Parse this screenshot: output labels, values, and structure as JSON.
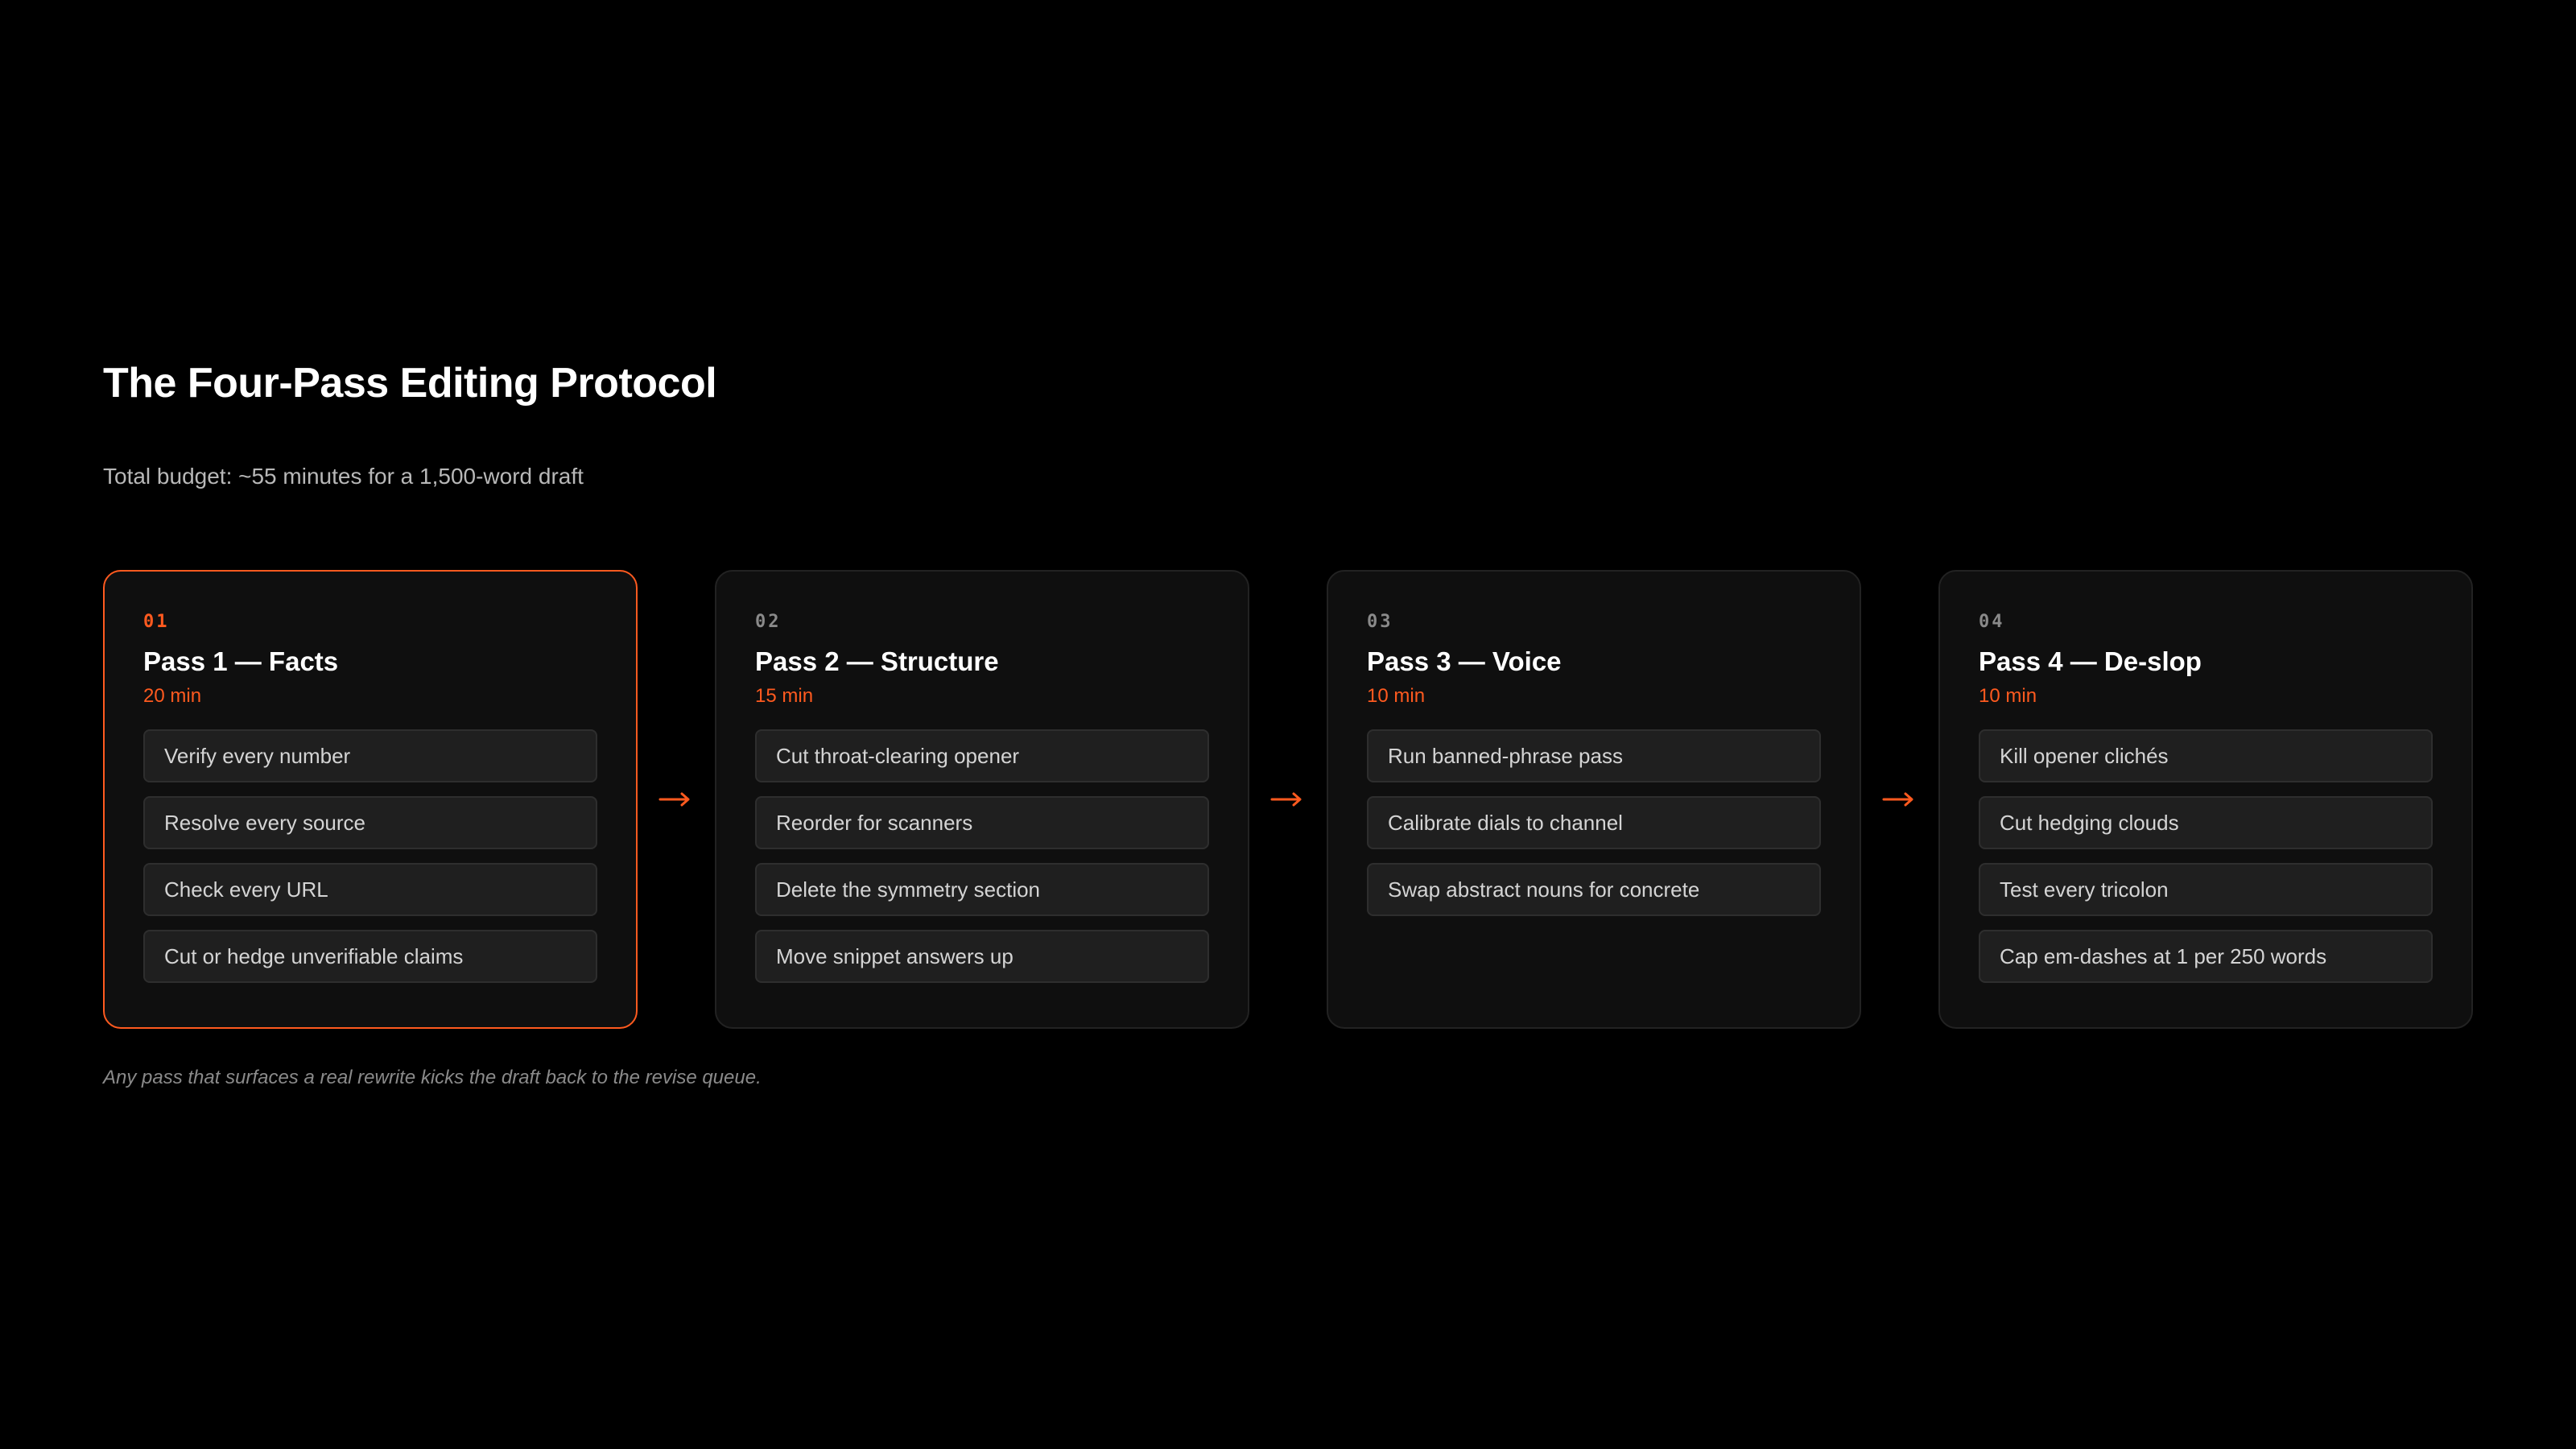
{
  "header": {
    "title": "The Four-Pass Editing Protocol",
    "subtitle": "Total budget: ~55 minutes for a 1,500-word draft"
  },
  "colors": {
    "accent": "#ff5a1f",
    "background": "#000000",
    "card": "#0f0f0f",
    "item": "#1f1f1f"
  },
  "passes": [
    {
      "num": "01",
      "title": "Pass 1 — Facts",
      "time": "20 min",
      "active": true,
      "items": [
        "Verify every number",
        "Resolve every source",
        "Check every URL",
        "Cut or hedge unverifiable claims"
      ]
    },
    {
      "num": "02",
      "title": "Pass 2 — Structure",
      "time": "15 min",
      "active": false,
      "items": [
        "Cut throat-clearing opener",
        "Reorder for scanners",
        "Delete the symmetry section",
        "Move snippet answers up"
      ]
    },
    {
      "num": "03",
      "title": "Pass 3 — Voice",
      "time": "10 min",
      "active": false,
      "items": [
        "Run banned-phrase pass",
        "Calibrate dials to channel",
        "Swap abstract nouns for concrete"
      ]
    },
    {
      "num": "04",
      "title": "Pass 4 — De-slop",
      "time": "10 min",
      "active": false,
      "items": [
        "Kill opener clichés",
        "Cut hedging clouds",
        "Test every tricolon",
        "Cap em-dashes at 1 per 250 words"
      ]
    }
  ],
  "footnote": "Any pass that surfaces a real rewrite kicks the draft back to the revise queue."
}
